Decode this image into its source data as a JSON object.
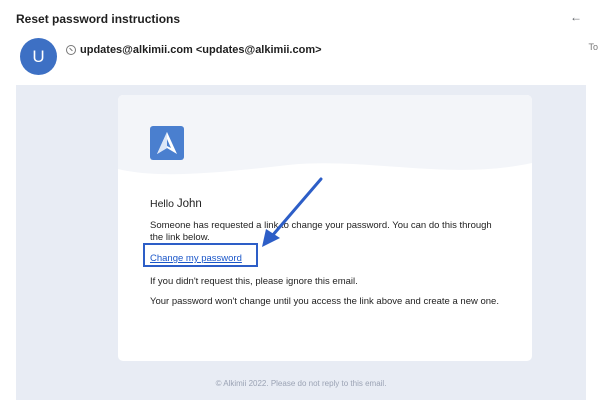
{
  "header": {
    "subject": "Reset password instructions",
    "back_icon": "←",
    "to_label": "To"
  },
  "sender": {
    "avatar_initial": "U",
    "address": "updates@alkimii.com <updates@alkimii.com>"
  },
  "email": {
    "greeting_prefix": "Hello ",
    "greeting_name": "John",
    "paragraph_1": "Someone has requested a link to change your password. You can do this through the link below.",
    "link_text": "Change my password",
    "paragraph_2": "If you didn't request this, please ignore this email.",
    "paragraph_3": "Your password won't change until you access the link above and create a new one.",
    "footer": "© Alkimii 2022. Please do not reply to this email."
  },
  "colors": {
    "accent": "#2d5ec7",
    "avatar": "#3d70c4",
    "email_background": "#e8ecf4",
    "logo": "#4a7fcf"
  },
  "icons": [
    "back-arrow-icon",
    "info-icon",
    "alkimii-logo-icon"
  ]
}
